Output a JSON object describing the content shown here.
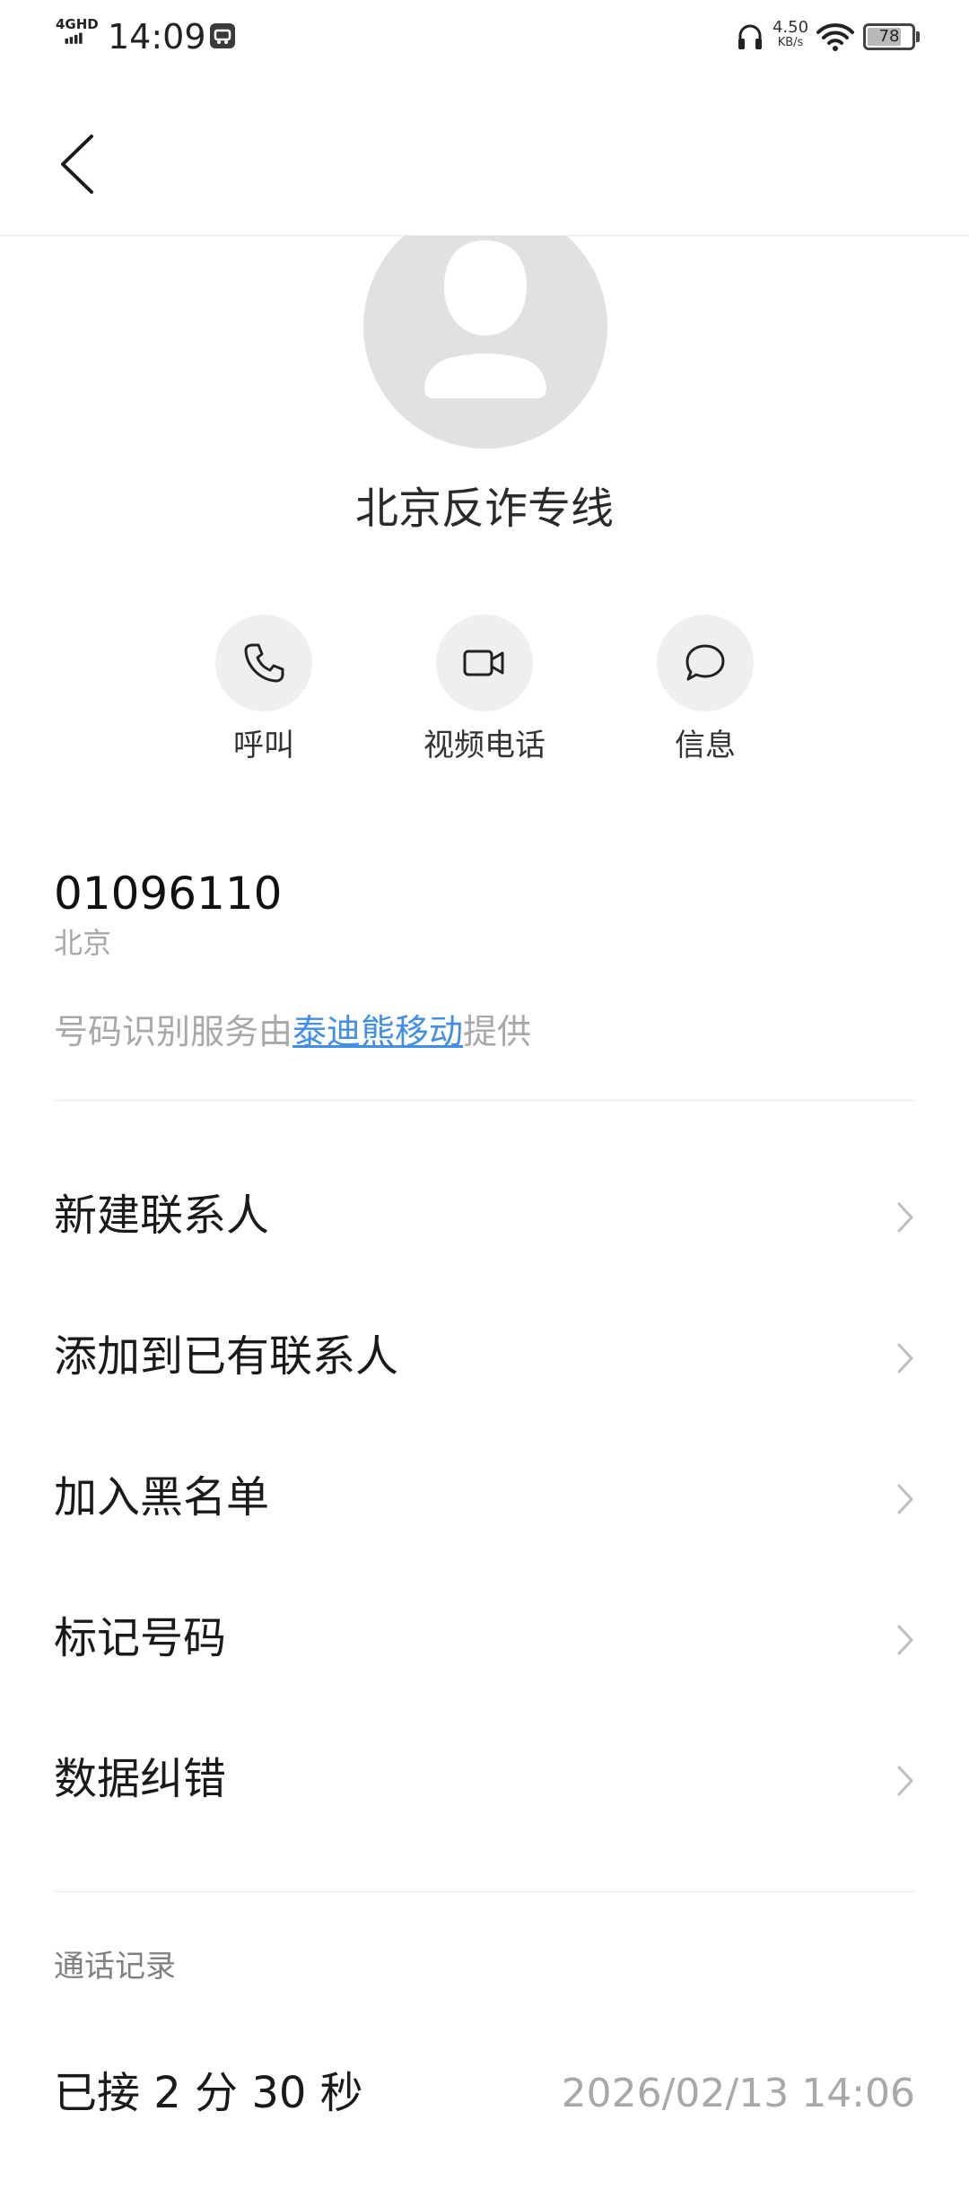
{
  "status_bar": {
    "network": "4GHD",
    "time": "14:09",
    "speed_value": "4.50",
    "speed_unit": "KB/s",
    "battery": "78",
    "battery_level": 0.78
  },
  "contact": {
    "name": "北京反诈专线"
  },
  "actions": {
    "call_label": "呼叫",
    "video_label": "视频电话",
    "message_label": "信息"
  },
  "number_info": {
    "number": "01096110",
    "location": "北京",
    "provider_prefix": "号码识别服务由",
    "provider_link": "泰迪熊移动",
    "provider_suffix": "提供"
  },
  "menu": {
    "items": [
      {
        "label": "新建联系人"
      },
      {
        "label": "添加到已有联系人"
      },
      {
        "label": "加入黑名单"
      },
      {
        "label": "标记号码"
      },
      {
        "label": "数据纠错"
      }
    ]
  },
  "call_log": {
    "title": "通话记录",
    "entries": [
      {
        "status": "已接 2 分 30 秒",
        "time": "2026/02/13 14:06"
      }
    ]
  },
  "colors": {
    "accent_link": "#3f8ee8",
    "secondary_text": "#a8a8a8",
    "avatar_bg": "#e1e1e1",
    "action_bg": "#efefef"
  }
}
